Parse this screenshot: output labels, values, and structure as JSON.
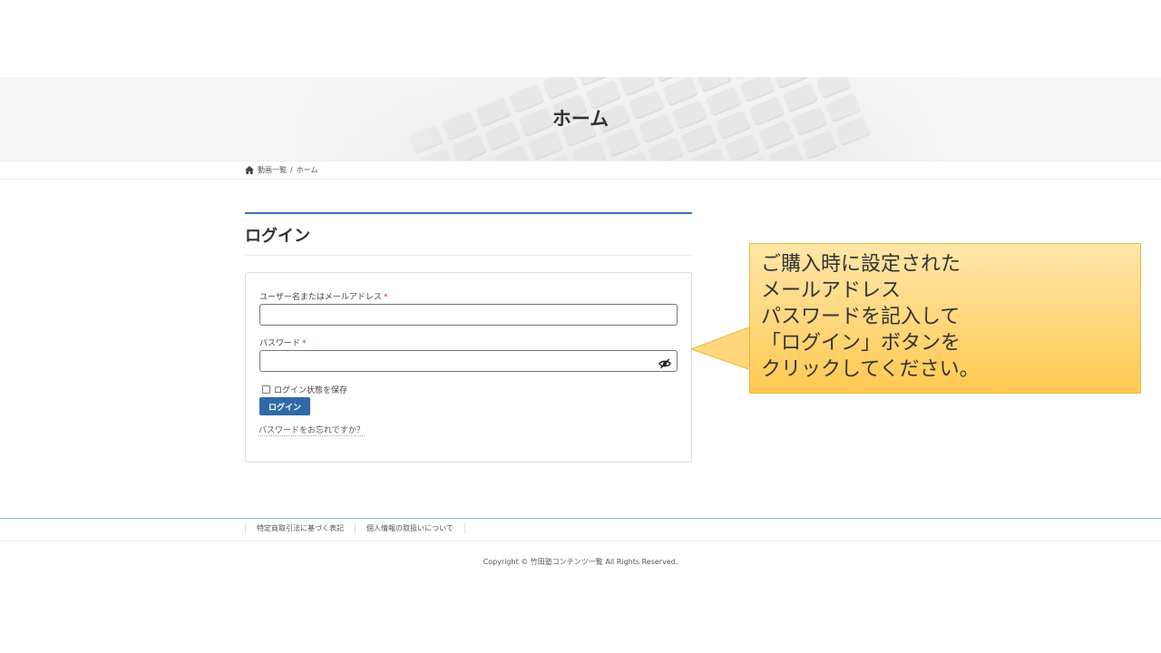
{
  "hero": {
    "title": "ホーム"
  },
  "breadcrumb": {
    "items": [
      "動画一覧",
      "ホーム"
    ],
    "separator": "/"
  },
  "login": {
    "heading": "ログイン",
    "username_label": "ユーザー名またはメールアドレス",
    "password_label": "パスワード",
    "required_mark": "*",
    "username_value": "",
    "password_value": "",
    "remember_label": "ログイン状態を保存",
    "remember_checked": false,
    "submit_label": "ログイン",
    "forgot_link": "パスワードをお忘れですか？"
  },
  "callout": {
    "text": "ご購入時に設定された\nメールアドレス\nパスワードを記入して\n「ログイン」ボタンを\nクリックしてください。"
  },
  "footer": {
    "links": [
      "特定商取引法に基づく表記",
      "個人情報の取扱いについて"
    ],
    "copyright": "Copyright © 竹田塾コンテンツ一覧 All Rights Reserved."
  },
  "colors": {
    "accent": "#3b6fb6",
    "button": "#2f6aa8",
    "callout_fill": "#ffd67a",
    "callout_border": "#e8b640",
    "required": "#c0392b"
  },
  "icons": {
    "breadcrumb_home": "home-icon",
    "password_toggle": "eye-slash-icon"
  }
}
